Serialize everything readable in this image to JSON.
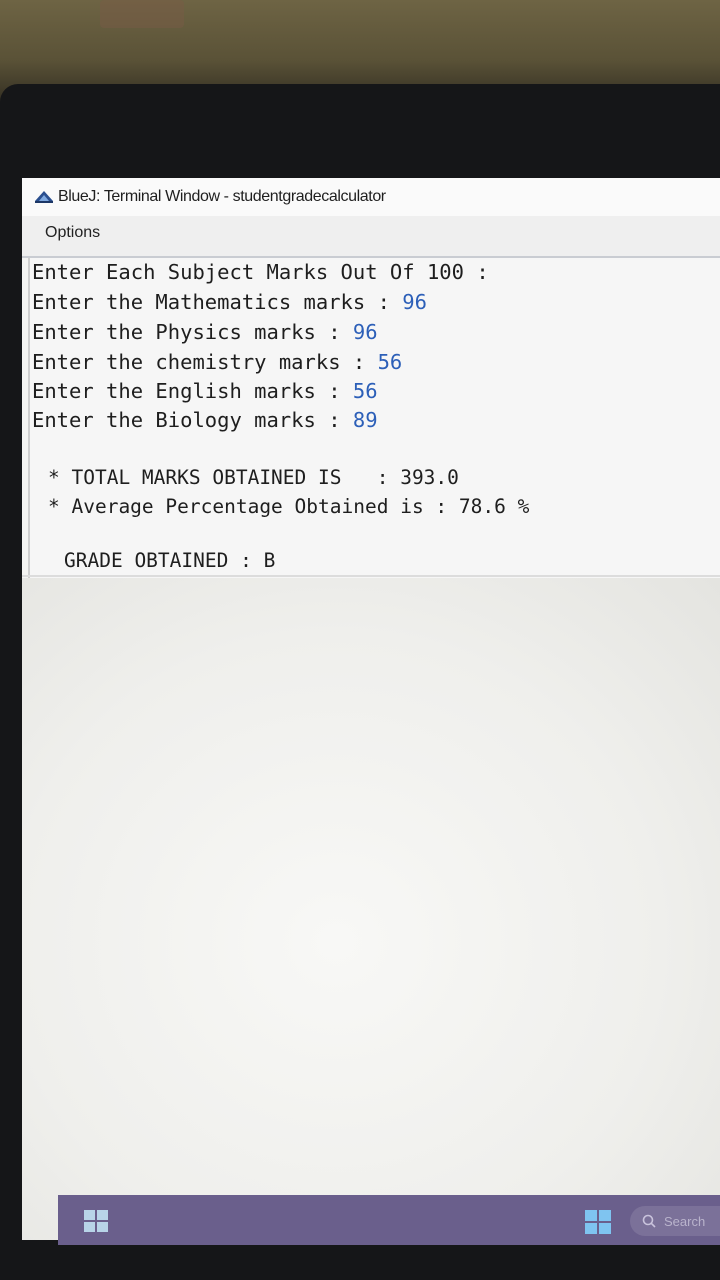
{
  "window": {
    "title": "BlueJ: Terminal Window - studentgradecalculator",
    "icon": "bluej-icon"
  },
  "menu": {
    "options_label": "Options"
  },
  "terminal": {
    "lines": [
      {
        "prompt": "Enter Each Subject Marks Out Of 100 :",
        "value": ""
      },
      {
        "prompt": "Enter the Mathematics marks : ",
        "value": "96"
      },
      {
        "prompt": "Enter the Physics marks : ",
        "value": "96"
      },
      {
        "prompt": "Enter the chemistry marks : ",
        "value": "56"
      },
      {
        "prompt": "Enter the English marks : ",
        "value": "56"
      },
      {
        "prompt": "Enter the Biology marks : ",
        "value": "89"
      }
    ],
    "total_line": "* TOTAL MARKS OBTAINED IS   : 393.0",
    "average_line": "* Average Percentage Obtained is : 78.6 %",
    "grade_line": "GRADE OBTAINED : B"
  },
  "taskbar": {
    "search_placeholder": "Search"
  },
  "colors": {
    "input_value": "#2c5fb8",
    "taskbar": "#6a5f8c"
  }
}
